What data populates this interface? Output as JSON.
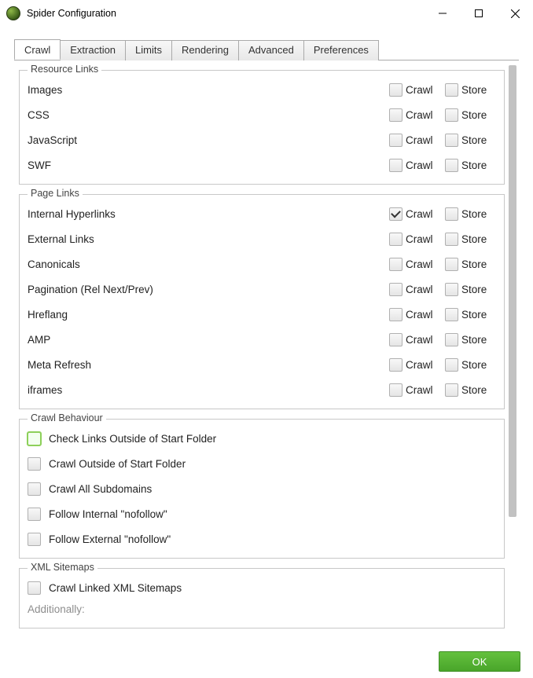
{
  "window": {
    "title": "Spider Configuration"
  },
  "tabs": [
    {
      "id": "crawl",
      "label": "Crawl",
      "active": true
    },
    {
      "id": "extraction",
      "label": "Extraction"
    },
    {
      "id": "limits",
      "label": "Limits"
    },
    {
      "id": "rendering",
      "label": "Rendering"
    },
    {
      "id": "advanced",
      "label": "Advanced"
    },
    {
      "id": "preferences",
      "label": "Preferences"
    }
  ],
  "labels": {
    "crawl": "Crawl",
    "store": "Store"
  },
  "groups": {
    "resource_links": {
      "title": "Resource Links",
      "items": [
        {
          "label": "Images",
          "crawl": false,
          "store": false
        },
        {
          "label": "CSS",
          "crawl": false,
          "store": false
        },
        {
          "label": "JavaScript",
          "crawl": false,
          "store": false
        },
        {
          "label": "SWF",
          "crawl": false,
          "store": false
        }
      ]
    },
    "page_links": {
      "title": "Page Links",
      "items": [
        {
          "label": "Internal Hyperlinks",
          "crawl": true,
          "store": false
        },
        {
          "label": "External Links",
          "crawl": false,
          "store": false
        },
        {
          "label": "Canonicals",
          "crawl": false,
          "store": false
        },
        {
          "label": "Pagination (Rel Next/Prev)",
          "crawl": false,
          "store": false
        },
        {
          "label": "Hreflang",
          "crawl": false,
          "store": false
        },
        {
          "label": "AMP",
          "crawl": false,
          "store": false
        },
        {
          "label": "Meta Refresh",
          "crawl": false,
          "store": false
        },
        {
          "label": "iframes",
          "crawl": false,
          "store": false
        }
      ]
    },
    "crawl_behaviour": {
      "title": "Crawl Behaviour",
      "items": [
        {
          "label": "Check Links Outside of Start Folder",
          "checked": false,
          "highlight": true
        },
        {
          "label": "Crawl Outside of Start Folder",
          "checked": false
        },
        {
          "label": "Crawl All Subdomains",
          "checked": false
        },
        {
          "label": "Follow Internal \"nofollow\"",
          "checked": false
        },
        {
          "label": "Follow External \"nofollow\"",
          "checked": false
        }
      ]
    },
    "xml_sitemaps": {
      "title": "XML Sitemaps",
      "items": [
        {
          "label": "Crawl Linked XML Sitemaps",
          "checked": false
        }
      ],
      "additionally_label": "Additionally:"
    }
  },
  "footer": {
    "ok_label": "OK"
  }
}
